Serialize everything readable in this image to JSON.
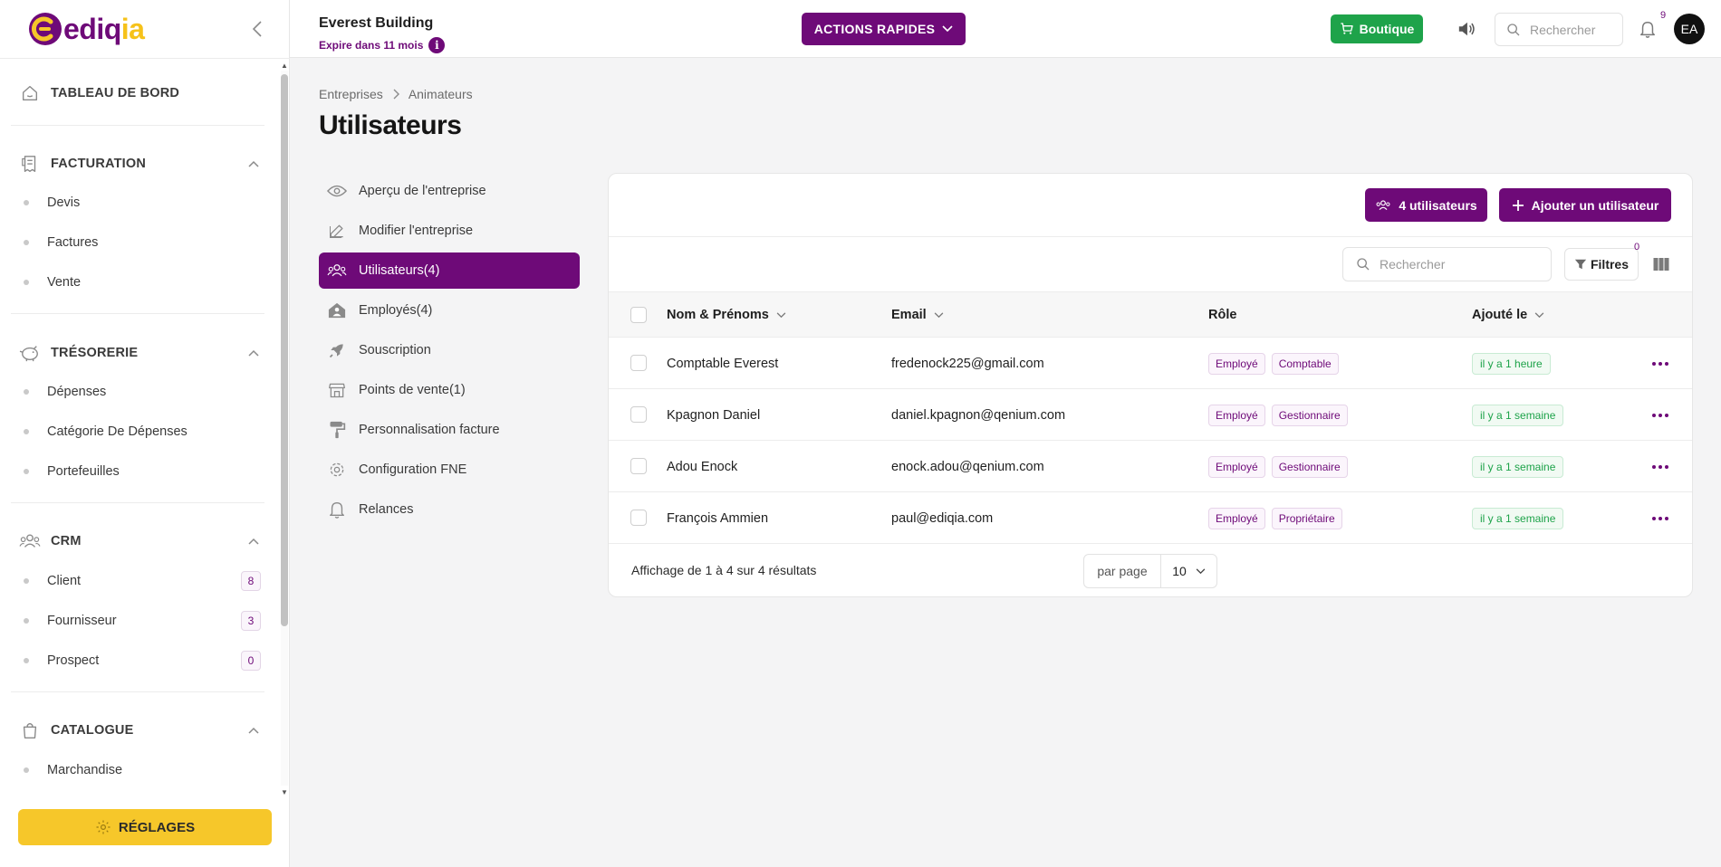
{
  "brand": {
    "logo_main": "ediq",
    "logo_accent": "ia",
    "primary": "#6e0a78",
    "accent": "#f6c72a",
    "success": "#1ea34a"
  },
  "sidebar": {
    "dashboard": "TABLEAU DE BORD",
    "sections": [
      {
        "label": "FACTURATION",
        "icon": "invoice-icon",
        "items": [
          {
            "label": "Devis"
          },
          {
            "label": "Factures"
          },
          {
            "label": "Vente"
          }
        ]
      },
      {
        "label": "TRÉSORERIE",
        "icon": "piggy-bank-icon",
        "items": [
          {
            "label": "Dépenses"
          },
          {
            "label": "Catégorie De Dépenses"
          },
          {
            "label": "Portefeuilles"
          }
        ]
      },
      {
        "label": "CRM",
        "icon": "users-icon",
        "items": [
          {
            "label": "Client",
            "count": "8"
          },
          {
            "label": "Fournisseur",
            "count": "3"
          },
          {
            "label": "Prospect",
            "count": "0"
          }
        ]
      },
      {
        "label": "CATALOGUE",
        "icon": "bag-icon",
        "items": [
          {
            "label": "Marchandise"
          }
        ]
      }
    ],
    "settings": "RÉGLAGES"
  },
  "header": {
    "company": "Everest Building",
    "expire": "Expire dans 11 mois",
    "info": "i",
    "quick_actions": "ACTIONS RAPIDES",
    "boutique": "Boutique",
    "search_placeholder": "Rechercher",
    "notifications": "9",
    "avatar": "EA"
  },
  "breadcrumb": {
    "items": [
      "Entreprises",
      "Animateurs"
    ]
  },
  "page_title": "Utilisateurs",
  "submenu": [
    {
      "label": "Aperçu de l'entreprise",
      "icon": "eye-icon"
    },
    {
      "label": "Modifier l'entreprise",
      "icon": "edit-icon"
    },
    {
      "label": "Utilisateurs(4)",
      "icon": "users-icon",
      "active": true
    },
    {
      "label": "Employés(4)",
      "icon": "employee-house-icon"
    },
    {
      "label": "Souscription",
      "icon": "rocket-icon"
    },
    {
      "label": "Points de vente(1)",
      "icon": "store-icon"
    },
    {
      "label": "Personnalisation facture",
      "icon": "paint-roller-icon"
    },
    {
      "label": "Configuration FNE",
      "icon": "gear-icon"
    },
    {
      "label": "Relances",
      "icon": "bell-icon"
    }
  ],
  "users_card": {
    "users_button": "4 utilisateurs",
    "add_button": "Ajouter un utilisateur",
    "search_placeholder": "Rechercher",
    "filters_label": "Filtres",
    "filters_count": "0",
    "columns": {
      "name": "Nom & Prénoms",
      "email": "Email",
      "role": "Rôle",
      "added": "Ajouté le"
    },
    "rows": [
      {
        "name": "Comptable Everest",
        "email": "fredenock225@gmail.com",
        "roles": [
          "Employé",
          "Comptable"
        ],
        "added": "il y a 1 heure"
      },
      {
        "name": "Kpagnon Daniel",
        "email": "daniel.kpagnon@qenium.com",
        "roles": [
          "Employé",
          "Gestionnaire"
        ],
        "added": "il y a 1 semaine"
      },
      {
        "name": "Adou Enock",
        "email": "enock.adou@qenium.com",
        "roles": [
          "Employé",
          "Gestionnaire"
        ],
        "added": "il y a 1 semaine"
      },
      {
        "name": "François Ammien",
        "email": "paul@ediqia.com",
        "roles": [
          "Employé",
          "Propriétaire"
        ],
        "added": "il y a 1 semaine"
      }
    ],
    "results": "Affichage de 1 à 4 sur 4 résultats",
    "per_page_label": "par page",
    "per_page_value": "10"
  }
}
